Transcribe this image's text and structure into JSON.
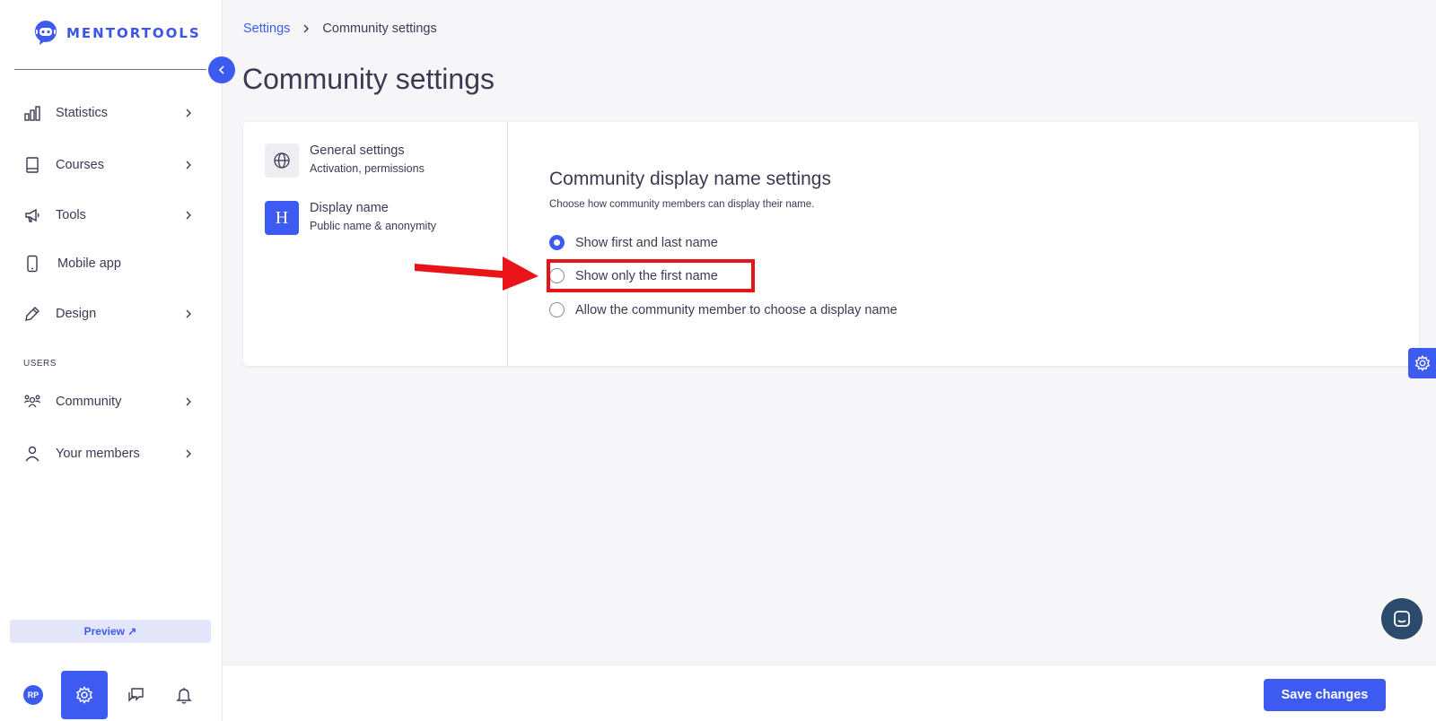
{
  "brand": {
    "name": "MENTORTOOLS",
    "accent": "#3d5af1"
  },
  "sidebar": {
    "items": [
      {
        "label": "Statistics",
        "icon": "bar-chart-icon"
      },
      {
        "label": "Courses",
        "icon": "book-icon"
      },
      {
        "label": "Tools",
        "icon": "megaphone-icon"
      },
      {
        "label": "Mobile app",
        "icon": "phone-icon"
      },
      {
        "label": "Design",
        "icon": "pencil-icon"
      }
    ],
    "section_label": "USERS",
    "user_items": [
      {
        "label": "Community",
        "icon": "group-icon"
      },
      {
        "label": "Your members",
        "icon": "person-icon"
      }
    ],
    "preview_label": "Preview ↗",
    "avatar_initials": "RP"
  },
  "breadcrumb": {
    "parent": "Settings",
    "current": "Community settings"
  },
  "page": {
    "title": "Community settings"
  },
  "settings_menu": [
    {
      "title": "General settings",
      "subtitle": "Activation, permissions",
      "icon": "globe-icon"
    },
    {
      "title": "Display name",
      "subtitle": "Public name & anonymity",
      "icon": "heading-icon",
      "letter": "H"
    }
  ],
  "display_name": {
    "title": "Community display name settings",
    "description": "Choose how community members can display their name.",
    "options": [
      {
        "label": "Show first and last name",
        "selected": true
      },
      {
        "label": "Show only the first name",
        "selected": false
      },
      {
        "label": "Allow the community member to choose a display name",
        "selected": false
      }
    ]
  },
  "footer": {
    "save_label": "Save changes"
  },
  "annotation_color": "#e8141a"
}
